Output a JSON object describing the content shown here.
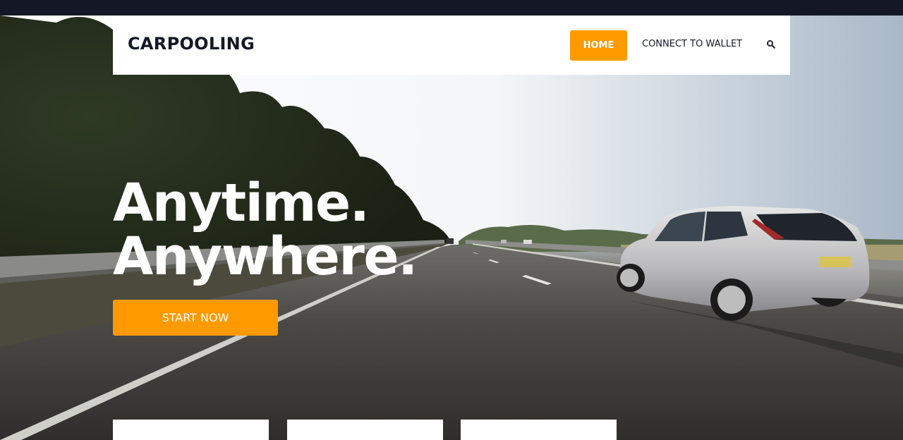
{
  "colors": {
    "accent": "#fe9a00",
    "dark": "#141826",
    "white": "#ffffff"
  },
  "navbar": {
    "brand": "CARPOOLING",
    "home_label": "HOME",
    "wallet_label": "CONNECT TO WALLET",
    "search_icon": "search-icon"
  },
  "hero": {
    "line1": "Anytime.",
    "line2": "Anywhere.",
    "cta_label": "START NOW",
    "background": "highway-with-car-photo"
  },
  "cards": [
    {
      "id": "card-1"
    },
    {
      "id": "card-2"
    },
    {
      "id": "card-3"
    }
  ]
}
